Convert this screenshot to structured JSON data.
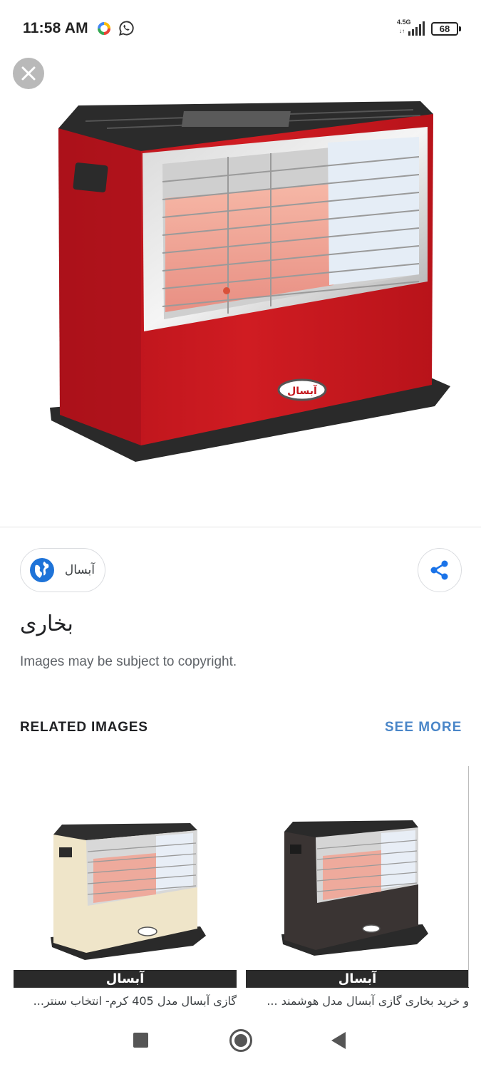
{
  "status_bar": {
    "time": "11:58 AM",
    "network": "4.5G",
    "network_arrows": "↓↑",
    "battery": "68",
    "icons": [
      "app-notification-icon",
      "whatsapp-icon",
      "signal-icon",
      "battery-icon"
    ]
  },
  "viewer": {
    "close_icon": "close-icon",
    "hero_image": "red-gas-heater-image",
    "source": {
      "name": "آبسال",
      "icon": "globe-icon"
    },
    "share_icon": "share-icon",
    "title": "بخاری",
    "copyright": "Images may be subject to copyright."
  },
  "related": {
    "heading": "RELATED IMAGES",
    "see_more": "SEE MORE",
    "items": [
      {
        "image": "cream-gas-heater-image",
        "brand_band": "آبسال",
        "caption": "گازی آبسال مدل 405 کرم- انتخاب سنتر..."
      },
      {
        "image": "black-gas-heater-image",
        "brand_band": "آبسال",
        "caption": "و خرید بخاری گازی آبسال مدل هوشمند ..."
      }
    ]
  },
  "nav_bar": {
    "icons": [
      "recents-square-icon",
      "home-circle-icon",
      "back-triangle-icon"
    ]
  },
  "colors": {
    "accent": "#4a86c8",
    "heater_red": "#c4161c",
    "heater_cream": "#efe5c9",
    "heater_black": "#3a3433"
  }
}
